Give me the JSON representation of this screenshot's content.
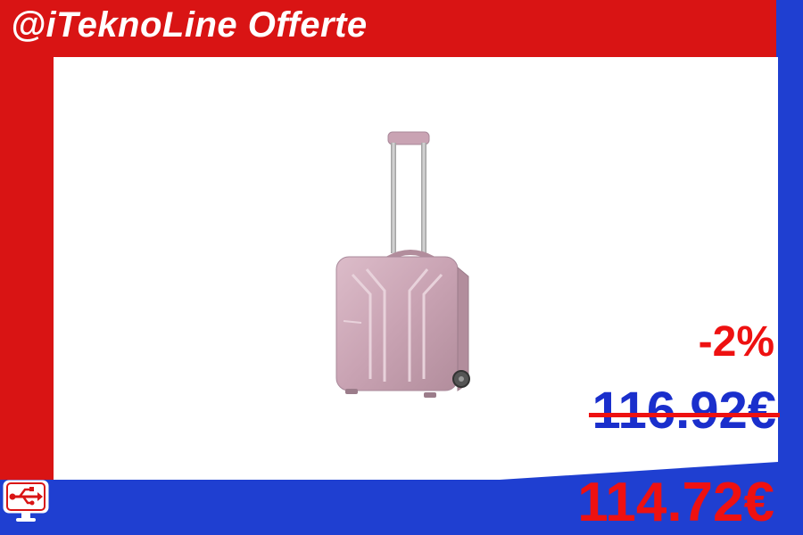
{
  "header": {
    "brand_title": "@iTeknoLine Offerte"
  },
  "product": {
    "image_icon": "rolling-laptop-trolley-case",
    "color": "#c9a3b3"
  },
  "pricing": {
    "discount": "-2%",
    "old_price": "116.92€",
    "new_price": "114.72€"
  },
  "logo": {
    "icon": "usb-monitor-logo-icon"
  },
  "colors": {
    "red": "#d91414",
    "blue": "#1f3fd1",
    "price_red": "#ee1111",
    "old_price_blue": "#1a2fcc"
  }
}
